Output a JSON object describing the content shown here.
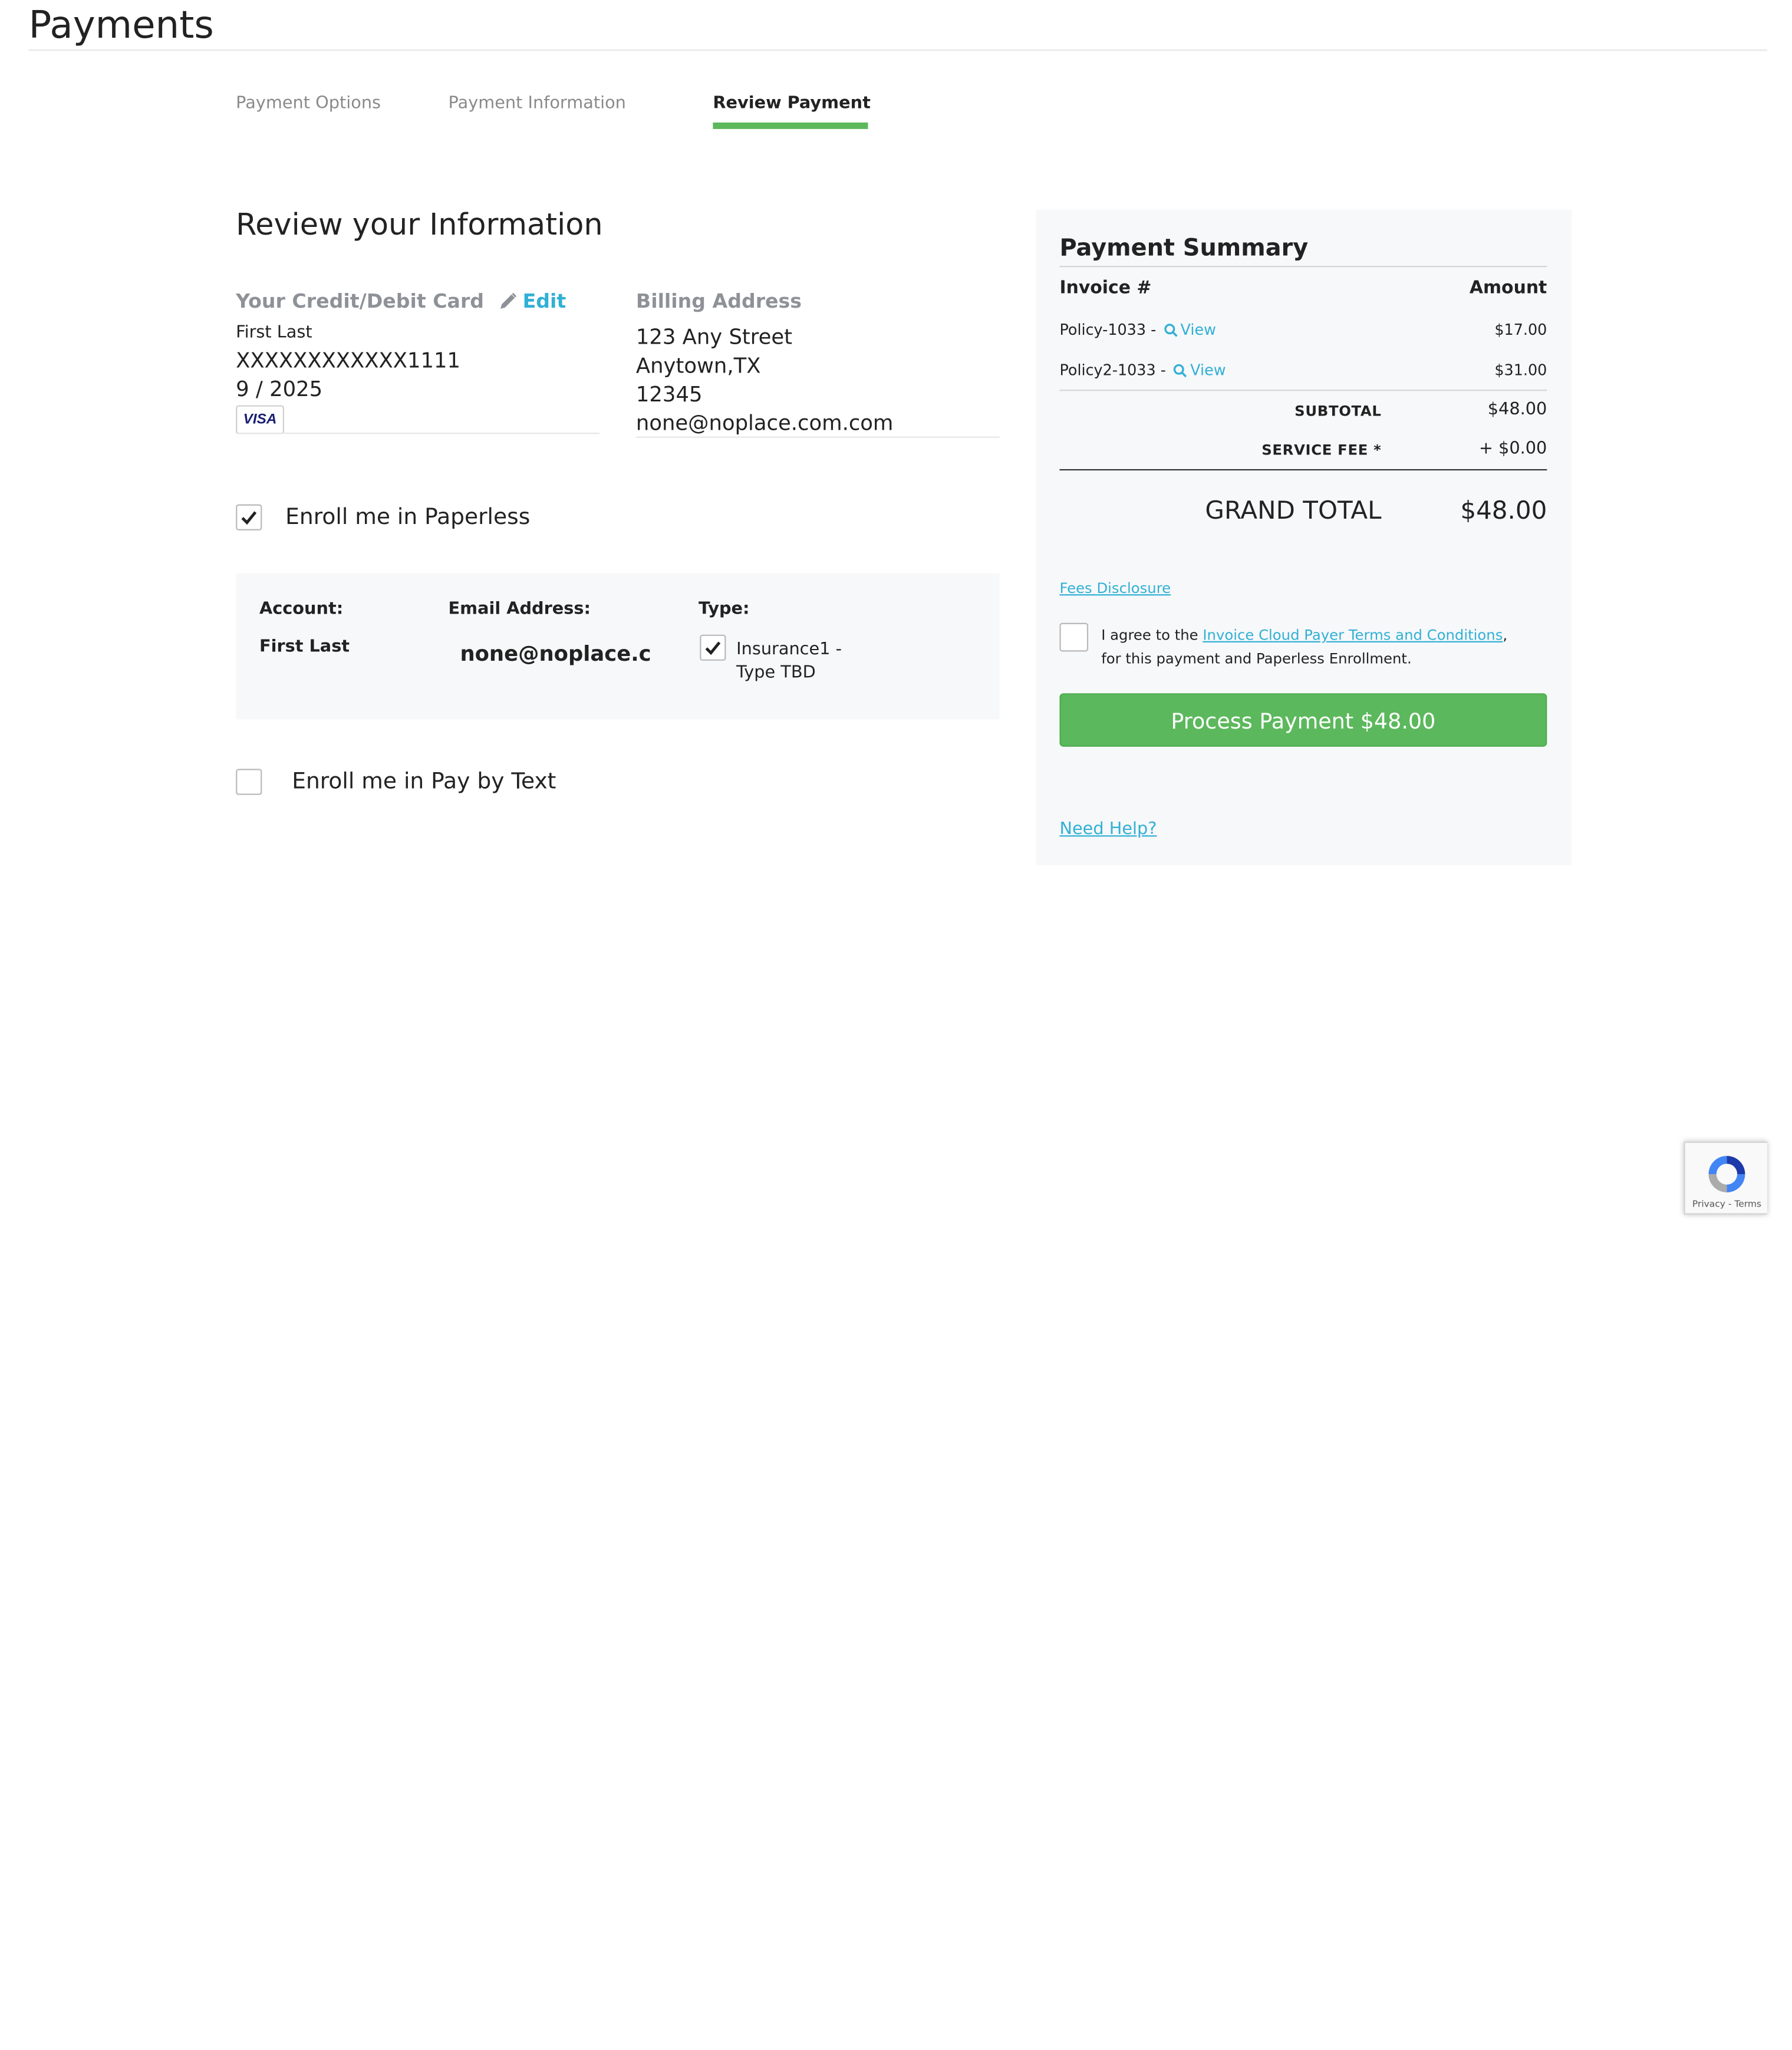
{
  "page": {
    "title": "Payments"
  },
  "steps": [
    "Payment Options",
    "Payment Information",
    "Review Payment"
  ],
  "review": {
    "heading": "Review your Information",
    "card": {
      "label": "Your Credit/Debit Card",
      "edit": "Edit",
      "name": "First Last",
      "number": "XXXXXXXXXXXX1111",
      "expiry": "9 / 2025",
      "brand": "VISA"
    },
    "billing": {
      "label": "Billing Address",
      "street": "123 Any Street",
      "city": "Anytown,TX",
      "zip": "12345",
      "email": "none@noplace.com.com"
    }
  },
  "paperless": {
    "label": "Enroll me in Paperless",
    "checked": true,
    "account_header": "Account:",
    "email_header": "Email Address:",
    "type_header": "Type:",
    "account": "First Last",
    "email": "none@noplace.c",
    "type_line1": "Insurance1 -",
    "type_line2": "Type TBD",
    "type_checked": true
  },
  "pay_by_text": {
    "label": "Enroll me in Pay by Text",
    "checked": false
  },
  "summary": {
    "title": "Payment Summary",
    "invoice_header": "Invoice #",
    "amount_header": "Amount",
    "invoices": [
      {
        "id": "Policy-1033 -",
        "view": "View",
        "amount": "$17.00"
      },
      {
        "id": "Policy2-1033 -",
        "view": "View",
        "amount": "$31.00"
      }
    ],
    "subtotal_label": "SUBTOTAL",
    "subtotal": "$48.00",
    "fee_label": "SERVICE FEE *",
    "fee": "+ $0.00",
    "grand_label": "GRAND TOTAL",
    "grand": "$48.00",
    "fees_disclosure": "Fees Disclosure",
    "terms_pre": "I agree to the ",
    "terms_link": "Invoice Cloud Payer Terms and Conditions",
    "terms_post": ", for this payment and Paperless Enrollment.",
    "button": "Process Payment $48.00",
    "help": "Need Help?"
  },
  "recaptcha": {
    "links": "Privacy - Terms"
  },
  "colors": {
    "accent_green": "#5cb85c",
    "link_blue": "#31b0d5",
    "panel_bg": "#f7f8fa"
  }
}
